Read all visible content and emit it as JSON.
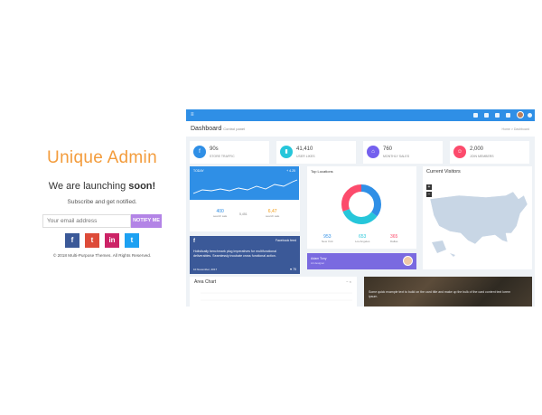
{
  "promo": {
    "title": "Unique Admin",
    "launch_text": "We are launching",
    "launch_bold": "soon!",
    "subscribe_text": "Subscribe and get notified.",
    "email_placeholder": "Your email address",
    "notify_label": "NOTIFY ME",
    "social": [
      "f",
      "t",
      "in",
      "t"
    ],
    "social_colors": [
      "#3b5998",
      "#dd4b39",
      "#cc2366",
      "#1da1f2"
    ],
    "copyright": "© 2018 Multi-Purpose Themes. All Rights Reserved."
  },
  "dashboard": {
    "header_title": "Dashboard",
    "header_sub": "Control panel",
    "breadcrumb": "Home > Dashboard",
    "stats": [
      {
        "value": "90s",
        "label": "STORE TRAFFIC",
        "color": "#2f8fe6",
        "icon": "facebook-icon"
      },
      {
        "value": "41,410",
        "label": "USER LIKES",
        "color": "#26c6da",
        "icon": "chart-icon"
      },
      {
        "value": "760",
        "label": "MONTHLY SALES",
        "color": "#7460ee",
        "icon": "cart-icon"
      },
      {
        "value": "2,000",
        "label": "JOIN MEMBERS",
        "color": "#fc4b6c",
        "icon": "users-icon"
      }
    ],
    "line_card": {
      "title": "TODAY",
      "change": "+ 4.25",
      "metrics": [
        {
          "value": "400",
          "label": "search sale",
          "color": "#2f8fe6"
        },
        {
          "value": "5,451",
          "label": "",
          "color": "#888888"
        },
        {
          "value": "6,47",
          "label": "search sale",
          "color": "#f39c12"
        }
      ]
    },
    "donut_card": {
      "title": "Top Locations",
      "numbers": [
        {
          "value": "953",
          "label": "New York",
          "color": "#2f8fe6"
        },
        {
          "value": "653",
          "label": "Los Angeles",
          "color": "#26c6da"
        },
        {
          "value": "365",
          "label": "Dallas",
          "color": "#fc4b6c"
        }
      ]
    },
    "facebook": {
      "badge": "f",
      "title": "Facebook feed",
      "body": "Holistically benchmark plug imperatives for multifunctional deliverables. Seamlessly incubate cross functional action.",
      "date": "10 November, 2017",
      "stats": "♥ 75"
    },
    "profile": {
      "name": "Adam Tony",
      "sub": "Art designer"
    },
    "map": {
      "title": "Current Visitors",
      "zoom_in": "+",
      "zoom_out": "−"
    },
    "area": {
      "title": "Area Chart",
      "controls": "− ×"
    },
    "photo": {
      "text": "Some quick example text to build on the card title and make up the bulk of the card content text lorem ipsum."
    }
  }
}
